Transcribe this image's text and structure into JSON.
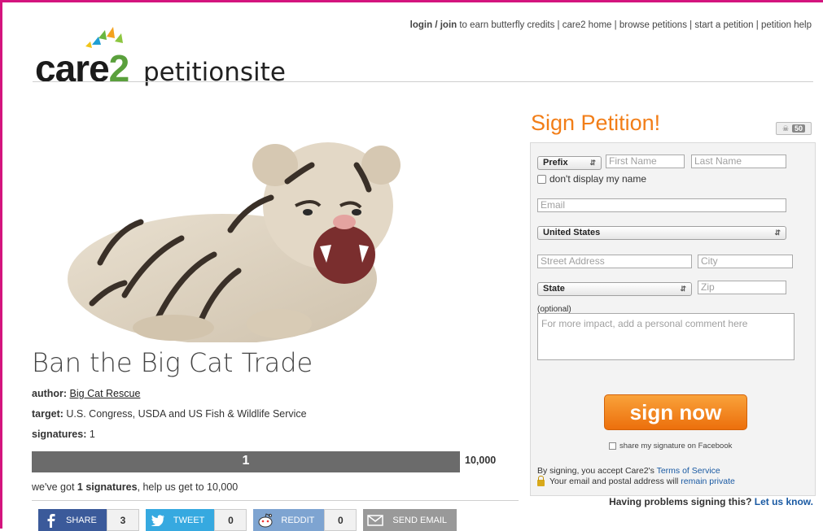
{
  "header": {
    "links": [
      {
        "text": "login / join",
        "bold": true
      },
      {
        "text": " to earn butterfly credits | "
      },
      {
        "text": "care2 home"
      },
      {
        "text": " | "
      },
      {
        "text": "browse petitions"
      },
      {
        "text": " | "
      },
      {
        "text": "start a petition"
      },
      {
        "text": " | "
      },
      {
        "text": "petition help"
      }
    ],
    "logo": {
      "care": "care",
      "two": "2",
      "site": "petitionsite"
    }
  },
  "petition": {
    "title": "Ban the Big Cat Trade",
    "author_label": "author:",
    "author": "Big Cat Rescue",
    "target_label": "target:",
    "target": "U.S. Congress, USDA and US Fish & Wildlife Service",
    "signatures_label": "signatures:",
    "signatures": "1",
    "progress": {
      "count": "1",
      "goal": "10,000",
      "fraction": 0.0001
    },
    "got_prefix": "we've got ",
    "got_bold": "1 signatures",
    "got_suffix": ", help us get to 10,000"
  },
  "share": [
    {
      "label": "SHARE",
      "count": "3",
      "icon": "facebook-icon"
    },
    {
      "label": "TWEET",
      "count": "0",
      "icon": "twitter-icon"
    },
    {
      "label": "REDDIT",
      "count": "0",
      "icon": "reddit-icon"
    },
    {
      "label": "SEND EMAIL",
      "icon": "email-icon"
    }
  ],
  "form": {
    "heading": "Sign Petition!",
    "badge_count": "50",
    "prefix": "Prefix",
    "first_name": "First Name",
    "last_name": "Last Name",
    "hide_name": "don't display my name",
    "email": "Email",
    "country": "United States",
    "street": "Street Address",
    "city": "City",
    "state": "State",
    "zip": "Zip",
    "optional": "(optional)",
    "comment": "For more impact, add a personal comment here",
    "sign_button": "sign now",
    "fb_share": "share my signature on Facebook",
    "tos_prefix": "By signing, you accept Care2's ",
    "tos_link": "Terms of Service",
    "privacy_prefix": "Your email and postal address will ",
    "privacy_link": "remain private",
    "problems_prefix": "Having problems signing this? ",
    "problems_link": "Let us know."
  },
  "colors": {
    "accent": "#f27e18",
    "brand_magenta": "#d4147e",
    "facebook": "#3b5a9a",
    "twitter": "#36a9e0"
  }
}
